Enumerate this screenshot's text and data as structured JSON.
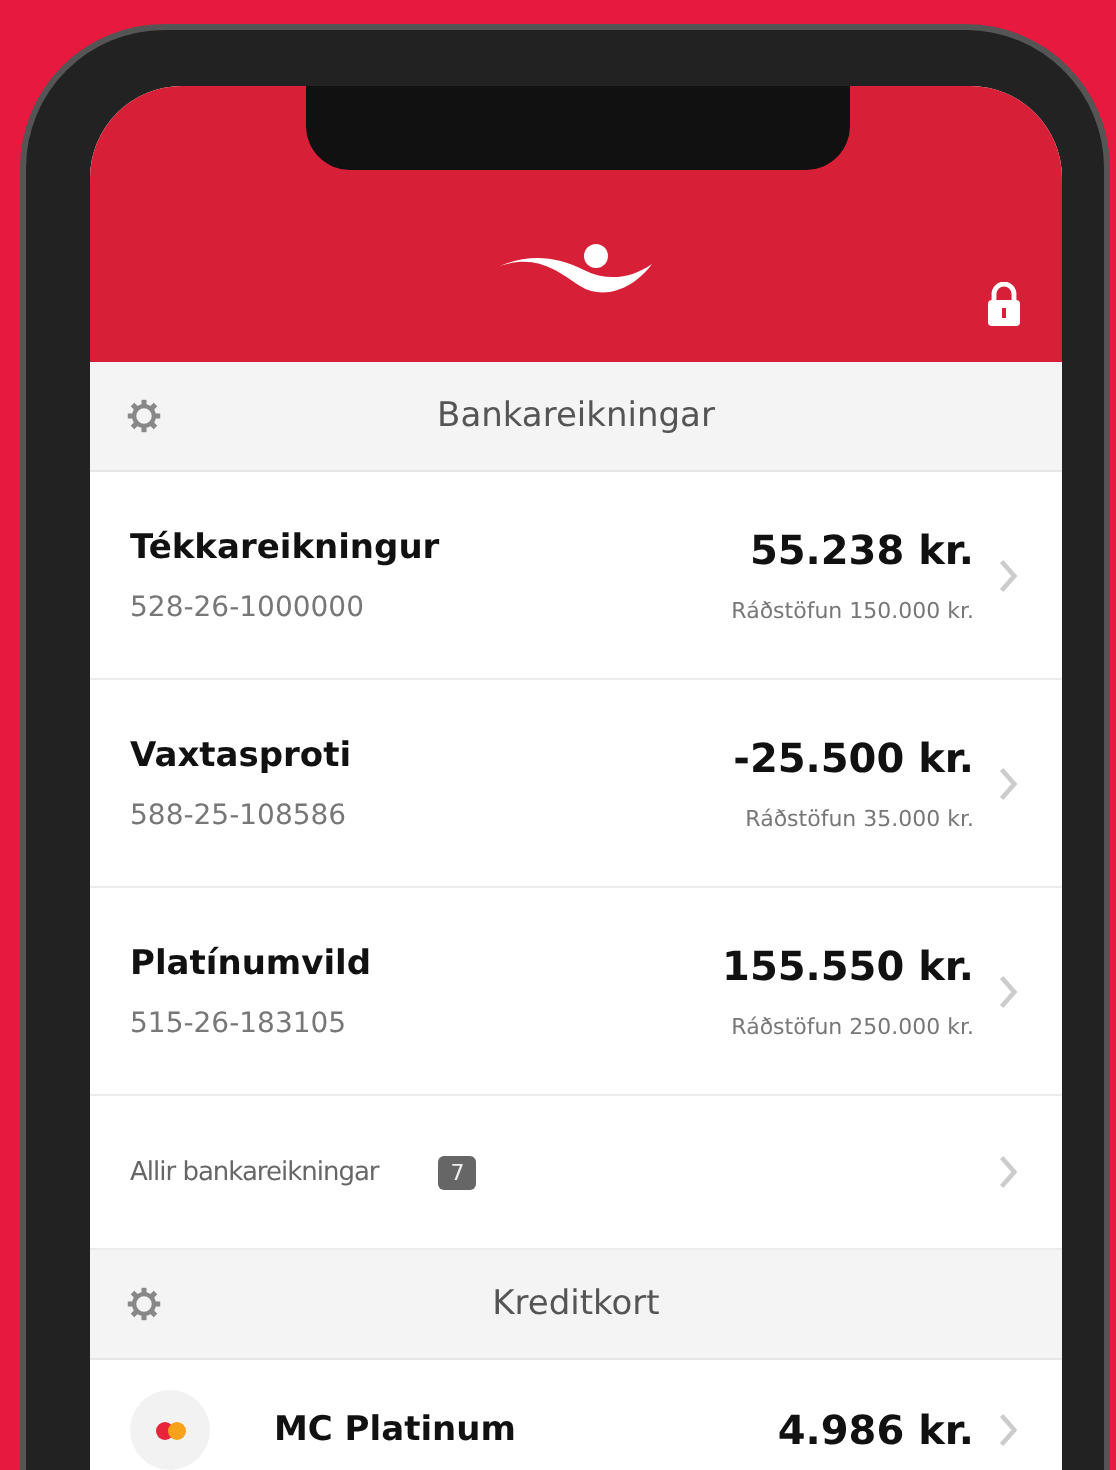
{
  "sections": [
    {
      "title": "Bankareikningar",
      "rows": [
        {
          "kind": "account",
          "name": "Tékkareikningur",
          "number": "528-26-1000000",
          "amount": "55.238 kr.",
          "available": "Ráðstöfun 150.000 kr."
        },
        {
          "kind": "account",
          "name": "Vaxtasproti",
          "number": "588-25-108586",
          "amount": "-25.500 kr.",
          "available": "Ráðstöfun 35.000 kr."
        },
        {
          "kind": "account",
          "name": "Platínumvild",
          "number": "515-26-183105",
          "amount": "155.550 kr.",
          "available": "Ráðstöfun 250.000 kr."
        },
        {
          "kind": "all_link",
          "label": "Allir bankareikningar",
          "count": "7"
        }
      ]
    },
    {
      "title": "Kreditkort",
      "rows": [
        {
          "kind": "card",
          "name": "MC Platinum",
          "amount": "4.986 kr."
        }
      ]
    }
  ]
}
